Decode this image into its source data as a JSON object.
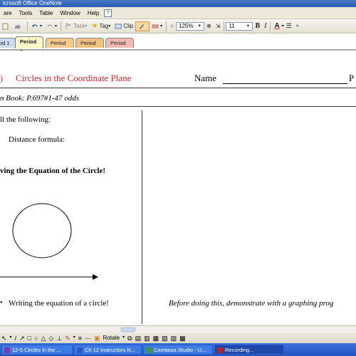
{
  "window": {
    "title": "icrosoft Office OneNote"
  },
  "menu": {
    "items": [
      "are",
      "Tools",
      "Table",
      "Window",
      "Help"
    ]
  },
  "toolbar": {
    "task_label": "Task",
    "tag_label": "Tag",
    "clip_label": "Clip",
    "zoom_value": "125%",
    "font_size_value": "11",
    "bold_label": "B",
    "italic_label": "I",
    "font_color_label": "A"
  },
  "tabs": [
    {
      "label": "od 1"
    },
    {
      "label": "Period 2"
    },
    {
      "label": "Period 3"
    },
    {
      "label": "Period 4"
    },
    {
      "label": "Period 6"
    }
  ],
  "page": {
    "title": "Circles in the Coordinate Plane",
    "name_label": "Name",
    "right_cut_label": "P",
    "assignment": "n Book:  P.697#1-47 odds",
    "left_column": {
      "recall": "ll the following:",
      "item_a": "Distance formula:",
      "heading": "ving the Equation of the Circle!",
      "writing": "Writing the equation of a circle!"
    },
    "right_column": {
      "note": "Before doing this, demonstrate with a graphing prog"
    }
  },
  "drawing_toolbar": {
    "rotate_label": "Rotate"
  },
  "taskbar": {
    "tasks": [
      {
        "label": "12-5 Circles in the ..."
      },
      {
        "label": "Ch 12 Instructors N..."
      },
      {
        "label": "Camtasia Studio - U..."
      },
      {
        "label": "Recording..."
      }
    ]
  },
  "colors": {
    "title_red": "#e02020",
    "tab_period2": "#fbf5c8",
    "tab_period3": "#f7c98a",
    "tab_period4": "#f3c080",
    "tab_period6": "#f2b9b0",
    "tab_period1": "#c9dcf2"
  }
}
